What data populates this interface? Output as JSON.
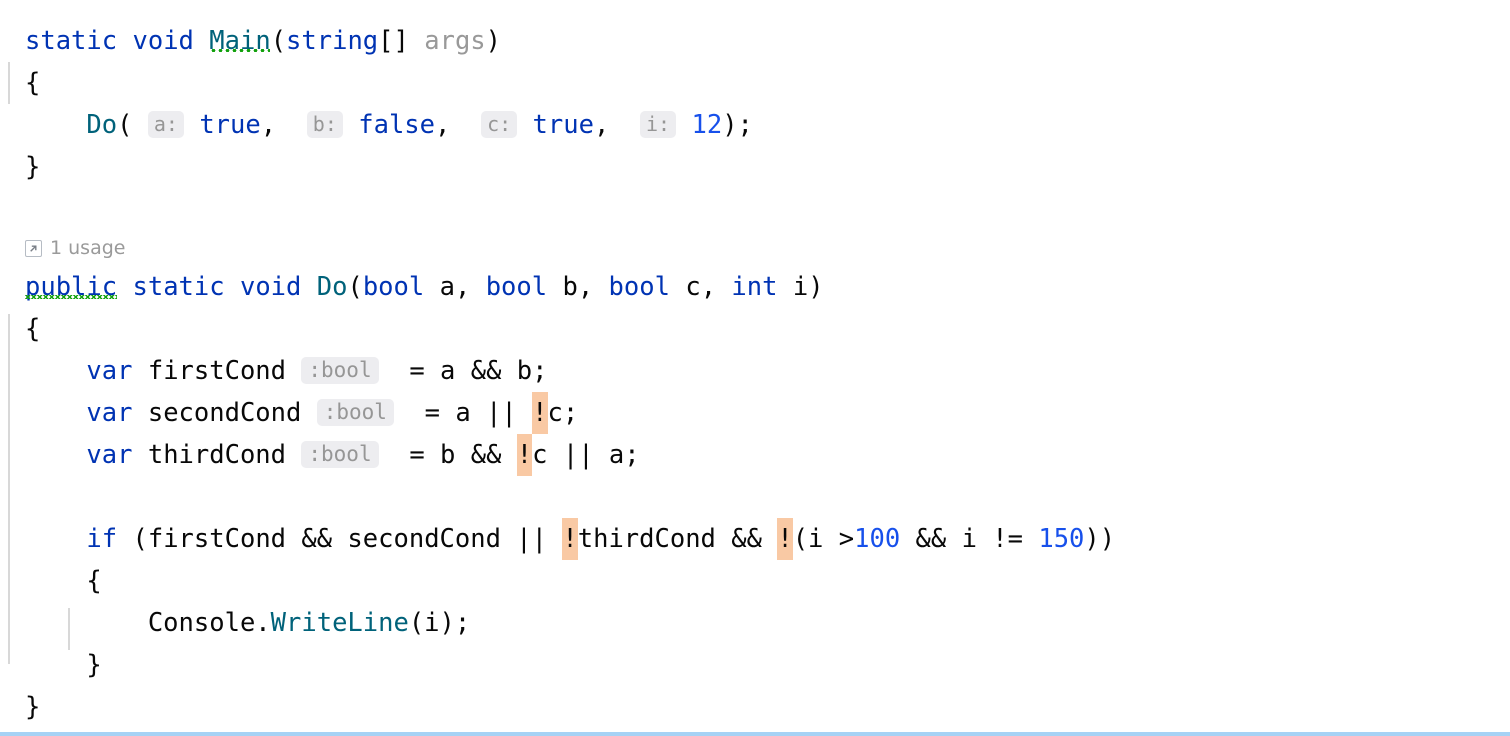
{
  "editor": {
    "language": "csharp",
    "theme": "IntelliJ Light",
    "background": "#ffffff",
    "bottom_border_color": "#a6d2f5",
    "colors": {
      "keyword": "#0033b3",
      "number": "#1750eb",
      "method": "#00627a",
      "text": "#080808",
      "unused_param": "#999999",
      "inlay_hint_bg": "#ededf0",
      "inlay_hint_fg": "#969696",
      "highlight_not_operator": "#f9c9a4",
      "indent_guide": "#d8d8d8",
      "squiggle_green": "#11a00c"
    }
  },
  "code_vision": {
    "icon": "usage-arrow-icon",
    "label": "1 usage"
  },
  "lines": {
    "l1": {
      "kw_static": "static",
      "kw_void": "void",
      "name_main": "Main",
      "kw_string": "string",
      "brackets": "[]",
      "param_args": "args"
    },
    "l2": {
      "brace": "{"
    },
    "l3": {
      "call": "Do",
      "hint_a": "a:",
      "val_a": "true",
      "hint_b": "b:",
      "val_b": "false",
      "hint_c": "c:",
      "val_c": "true",
      "hint_i": "i:",
      "val_i": "12"
    },
    "l4": {
      "brace": "}"
    },
    "l6": {
      "kw_public": "public",
      "kw_static": "static",
      "kw_void": "void",
      "name_do": "Do",
      "kw_bool1": "bool",
      "p_a": "a",
      "kw_bool2": "bool",
      "p_b": "b",
      "kw_bool3": "bool",
      "p_c": "c",
      "kw_int": "int",
      "p_i": "i"
    },
    "l7": {
      "brace": "{"
    },
    "l8": {
      "kw_var": "var",
      "name": "firstCond",
      "hint_type": ":bool",
      "expr": "= a && b;"
    },
    "l9": {
      "kw_var": "var",
      "name": "secondCond",
      "hint_type": ":bool",
      "expr_pre": "= a || ",
      "not": "!",
      "expr_post": "c;"
    },
    "l10": {
      "kw_var": "var",
      "name": "thirdCond",
      "hint_type": ":bool",
      "expr_pre": "= b && ",
      "not": "!",
      "expr_post": "c || a;"
    },
    "l12": {
      "kw_if": "if",
      "cond_1": "(firstCond && secondCond || ",
      "not_1": "!",
      "cond_2": "thirdCond && ",
      "not_2": "!",
      "cond_3": "(i >",
      "num_100": "100",
      "cond_4": " && i != ",
      "num_150": "150",
      "cond_5": "))"
    },
    "l13": {
      "brace": "{"
    },
    "l14": {
      "obj": "Console",
      "dot": ".",
      "method": "WriteLine",
      "args": "(i);"
    },
    "l15": {
      "brace": "}"
    },
    "l16": {
      "brace": "}"
    }
  }
}
